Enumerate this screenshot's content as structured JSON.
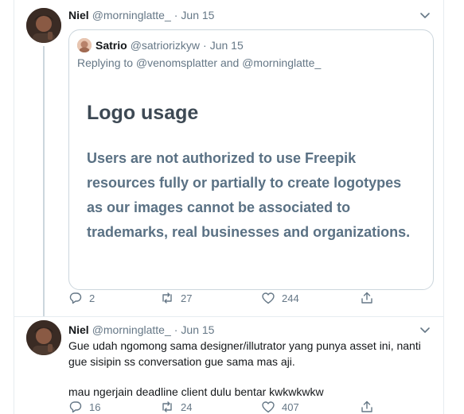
{
  "tweets": [
    {
      "author_name": "Niel",
      "handle": "@morninglatte_",
      "separator": "·",
      "time": "Jun 15",
      "quoted": {
        "author_name": "Satrio",
        "handle": "@satriorizkyw",
        "separator": "·",
        "time": "Jun 15",
        "replying_to": "Replying to @venomsplatter and @morninglatte_",
        "card_title": "Logo usage",
        "card_text": "Users are not authorized to use Freepik resources fully or partially to create logotypes as our images cannot be associated to trademarks, real businesses and organizations."
      },
      "replies": "2",
      "retweets": "27",
      "likes": "244"
    },
    {
      "author_name": "Niel",
      "handle": "@morninglatte_",
      "separator": "·",
      "time": "Jun 15",
      "text_line1": "Gue udah ngomong sama designer/illutrator yang punya asset ini, nanti gue sisipin ss conversation gue sama mas aji.",
      "text_line2": "mau ngerjain deadline client dulu bentar kwkwkwkw",
      "replies": "16",
      "retweets": "24",
      "likes": "407"
    }
  ],
  "icons": {
    "reply": "reply-icon",
    "retweet": "retweet-icon",
    "like": "heart-icon",
    "share": "share-icon",
    "caret": "chevron-down-icon"
  },
  "colors": {
    "secondary_text": "#657786",
    "border": "#ccd6dd",
    "card_title": "#3d4954",
    "card_text": "#5a7184"
  }
}
